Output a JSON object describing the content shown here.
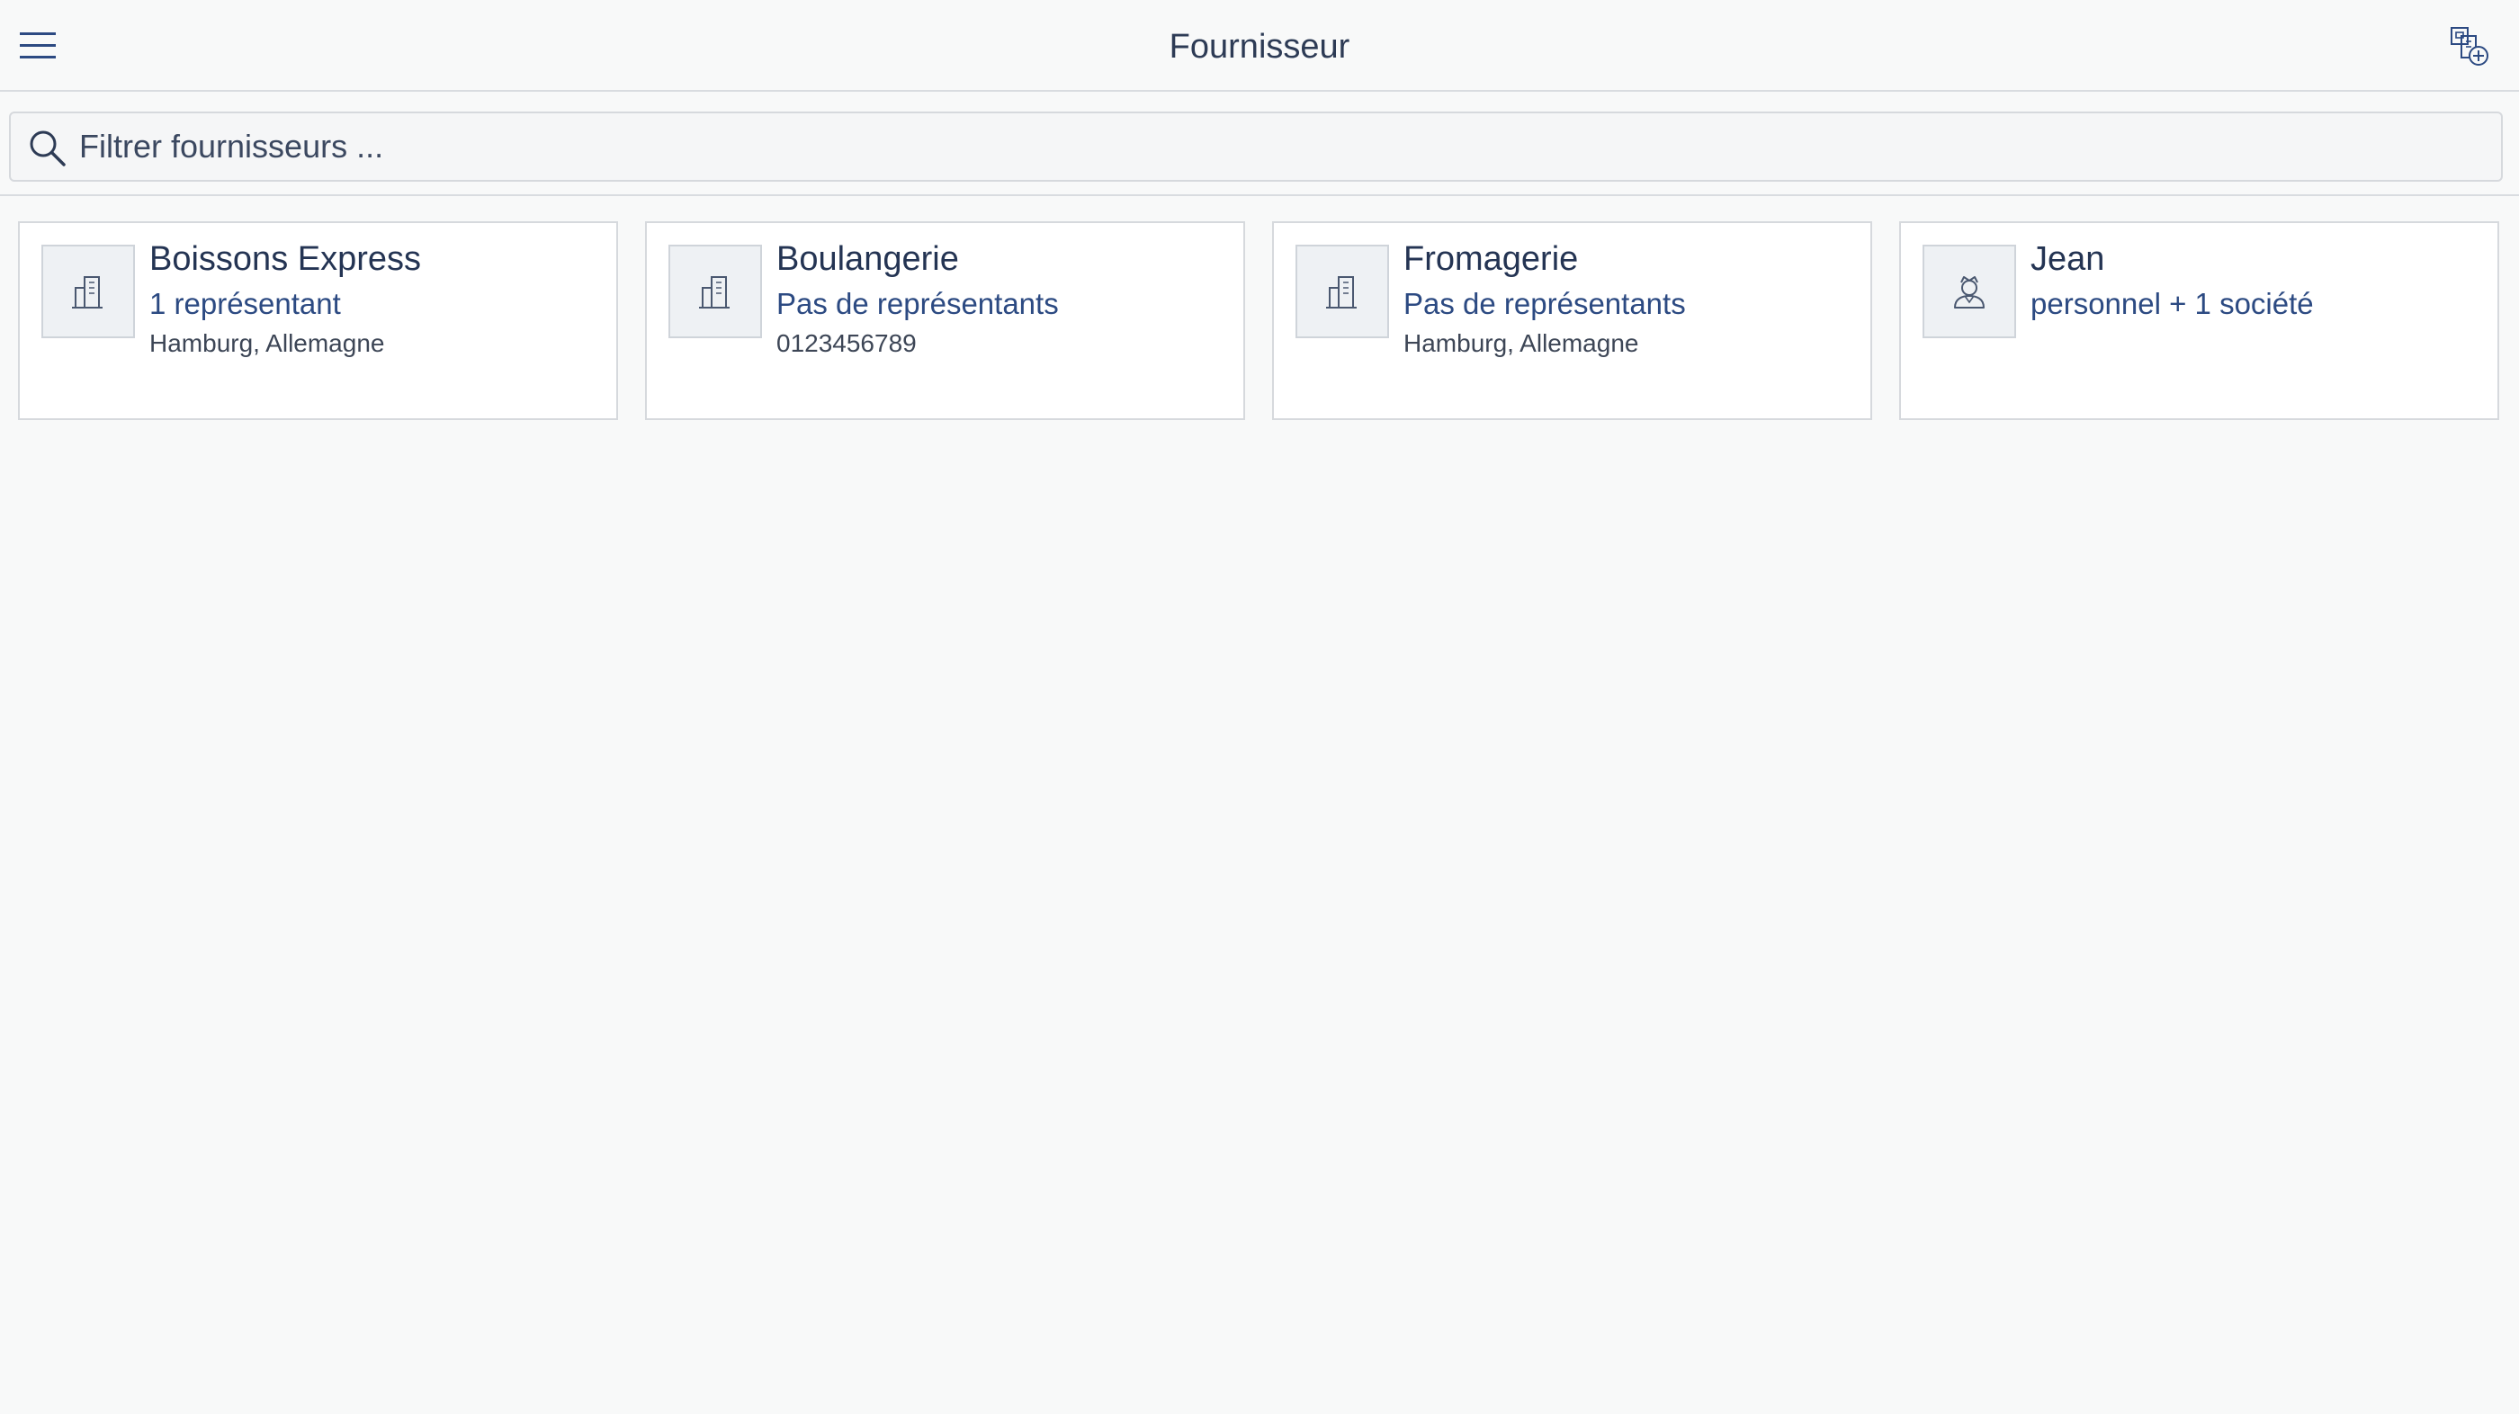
{
  "header": {
    "title": "Fournisseur",
    "menu_icon": "hamburger-menu-icon",
    "add_icon": "add-supplier-icon"
  },
  "search": {
    "placeholder": "Filtrer fournisseurs ...",
    "value": ""
  },
  "suppliers": [
    {
      "name": "Boissons Express",
      "subtitle": "1 représentant",
      "detail": "Hamburg, Allemagne",
      "icon": "building-icon"
    },
    {
      "name": "Boulangerie",
      "subtitle": "Pas de représentants",
      "detail": "0123456789",
      "icon": "building-icon"
    },
    {
      "name": "Fromagerie",
      "subtitle": "Pas de représentants",
      "detail": "Hamburg, Allemagne",
      "icon": "building-icon"
    },
    {
      "name": "Jean",
      "subtitle": "personnel + 1 société",
      "detail": "",
      "icon": "person-icon"
    }
  ],
  "colors": {
    "background": "#f8f9f9",
    "text_primary": "#243453",
    "text_accent": "#2c4a82",
    "border": "#d6d9dd"
  }
}
